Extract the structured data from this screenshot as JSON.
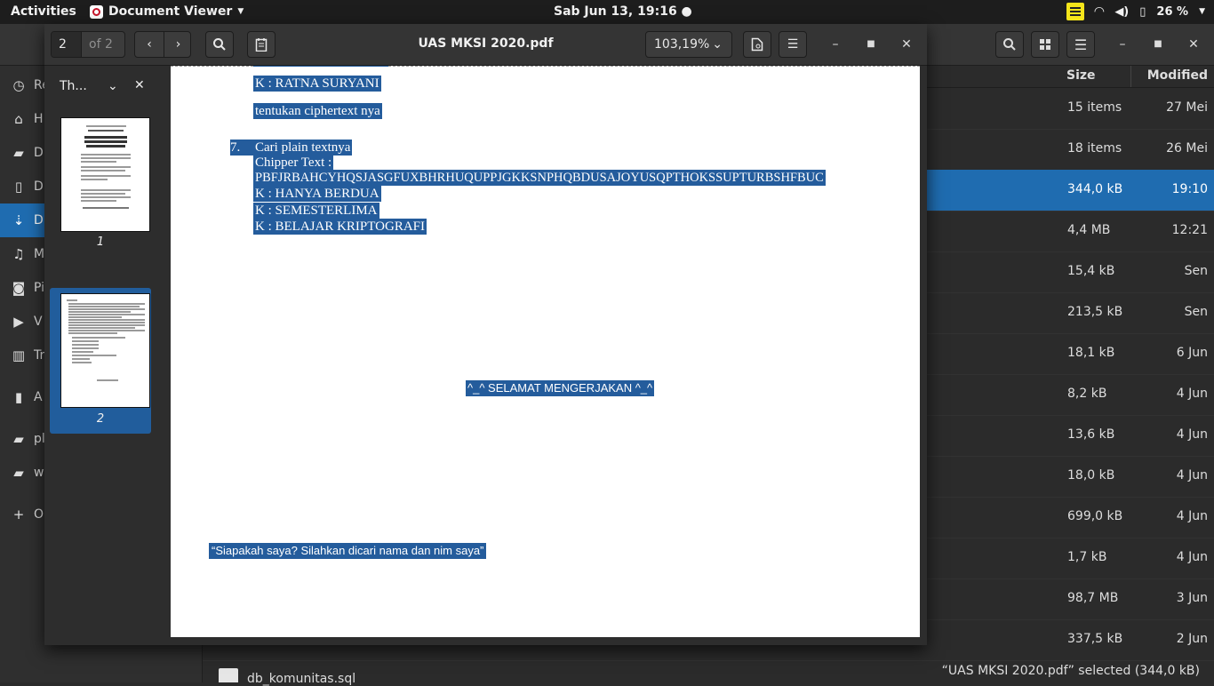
{
  "topbar": {
    "activities": "Activities",
    "app_name": "Document Viewer",
    "clock": "Sab Jun 13, 19:16 ●",
    "battery": "26 %"
  },
  "viewer": {
    "page_current": "2",
    "page_total": "of 2",
    "title": "UAS MKSI 2020.pdf",
    "zoom": "103,19%",
    "sidebar_mode": "Th...",
    "thumbnails": [
      {
        "label": "1"
      },
      {
        "label": "2"
      }
    ],
    "page": {
      "line_key_ratna": "K : RATNA SURYANI",
      "line_tentukan": "tentukan ciphertext nya",
      "item_number": "7.",
      "item_title": "Cari plain textnya",
      "chipper_label": "Chipper Text :",
      "ciphertext": "PBFJRBAHCYHQSJASGFUXBHRHUQUPPJGKKSNPHQBDUSAJOYUSQPTHOKSSUPTURBSHFBUC",
      "key1": "K : HANYA BERDUA",
      "key2": "K : SEMESTERLIMA",
      "key3": "K : BELAJAR KRIPTOGRAFI",
      "closing": "^_^ SELAMAT MENGERJAKAN ^_^",
      "footer": "“Siapakah saya? Silahkan dicari nama dan nim saya”"
    }
  },
  "files": {
    "col_size": "Size",
    "col_modified": "Modified",
    "rows": [
      {
        "size": "15 items",
        "modified": "27 Mei"
      },
      {
        "size": "18 items",
        "modified": "26 Mei"
      },
      {
        "size": "344,0 kB",
        "modified": "19:10"
      },
      {
        "size": "4,4 MB",
        "modified": "12:21"
      },
      {
        "size": "15,4 kB",
        "modified": "Sen"
      },
      {
        "size": "213,5 kB",
        "modified": "Sen"
      },
      {
        "size": "18,1 kB",
        "modified": "6 Jun"
      },
      {
        "size": "8,2 kB",
        "modified": "4 Jun"
      },
      {
        "size": "13,6 kB",
        "modified": "4 Jun"
      },
      {
        "size": "18,0 kB",
        "modified": "4 Jun"
      },
      {
        "size": "699,0 kB",
        "modified": "4 Jun"
      },
      {
        "size": "1,7 kB",
        "modified": "4 Jun"
      },
      {
        "size": "98,7 MB",
        "modified": "3 Jun"
      },
      {
        "size": "337,5 kB",
        "modified": "2 Jun"
      }
    ],
    "last_file": "db_komunitas.sql",
    "status": "“UAS MKSI 2020.pdf” selected (344,0 kB)"
  },
  "sidebar": {
    "items": [
      {
        "label": "Re",
        "icon": "clock-icon"
      },
      {
        "label": "H",
        "icon": "home-icon"
      },
      {
        "label": "D",
        "icon": "folder-icon"
      },
      {
        "label": "D",
        "icon": "document-icon"
      },
      {
        "label": "D",
        "icon": "download-icon"
      },
      {
        "label": "M",
        "icon": "music-icon"
      },
      {
        "label": "Pi",
        "icon": "camera-icon"
      },
      {
        "label": "V",
        "icon": "video-icon"
      },
      {
        "label": "Tr",
        "icon": "trash-icon"
      },
      {
        "label": "A",
        "icon": "usb-icon"
      },
      {
        "label": "pl",
        "icon": "folder-icon"
      },
      {
        "label": "w",
        "icon": "folder-icon"
      },
      {
        "label": "O",
        "icon": "plus-icon"
      }
    ]
  }
}
